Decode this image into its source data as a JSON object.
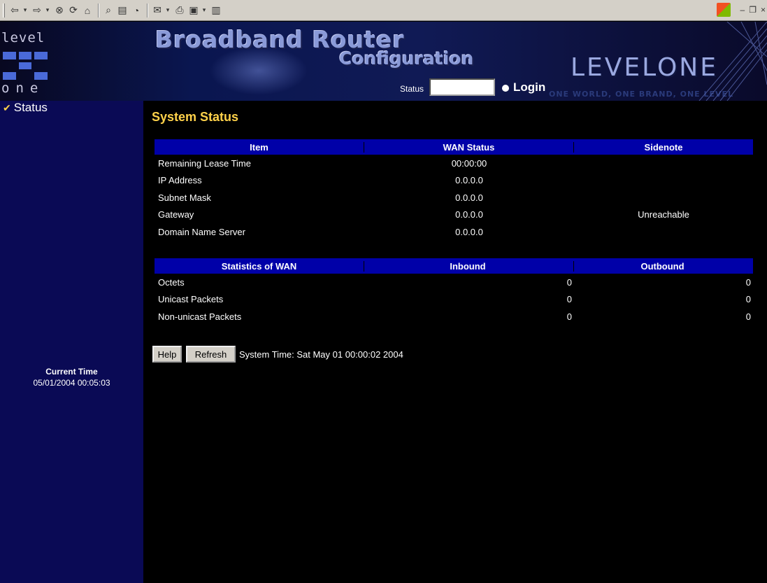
{
  "header": {
    "logo_top": "level",
    "logo_bottom": "one",
    "title_main": "Broadband Router",
    "title_sub": "Configuration",
    "brand": "LEVELONE",
    "slogan": "ONE WORLD, ONE BRAND, ONE LEVEL",
    "status_label": "Status",
    "status_value": "",
    "login_label": "Login"
  },
  "sidebar": {
    "nav_item": "Status",
    "current_time_title": "Current Time",
    "current_time_value": "05/01/2004 00:05:03"
  },
  "main": {
    "title": "System Status",
    "wan_table": {
      "headers": [
        "Item",
        "WAN Status",
        "Sidenote"
      ],
      "rows": [
        [
          "Remaining Lease Time",
          "00:00:00",
          ""
        ],
        [
          "IP Address",
          "0.0.0.0",
          ""
        ],
        [
          "Subnet Mask",
          "0.0.0.0",
          ""
        ],
        [
          "Gateway",
          "0.0.0.0",
          "Unreachable"
        ],
        [
          "Domain Name Server",
          "0.0.0.0",
          ""
        ]
      ]
    },
    "stats_table": {
      "headers": [
        "Statistics of WAN",
        "Inbound",
        "Outbound"
      ],
      "rows": [
        [
          "Octets",
          "0",
          "0"
        ],
        [
          "Unicast Packets",
          "0",
          "0"
        ],
        [
          "Non-unicast Packets",
          "0",
          "0"
        ]
      ]
    },
    "help_label": "Help",
    "refresh_label": "Refresh",
    "system_time": "System Time: Sat May 01 00:00:02 2004"
  },
  "colors": {
    "sidebar_bg": "#0a0a55",
    "table_header": "#0000a8",
    "title_yellow": "#ffd24a"
  }
}
